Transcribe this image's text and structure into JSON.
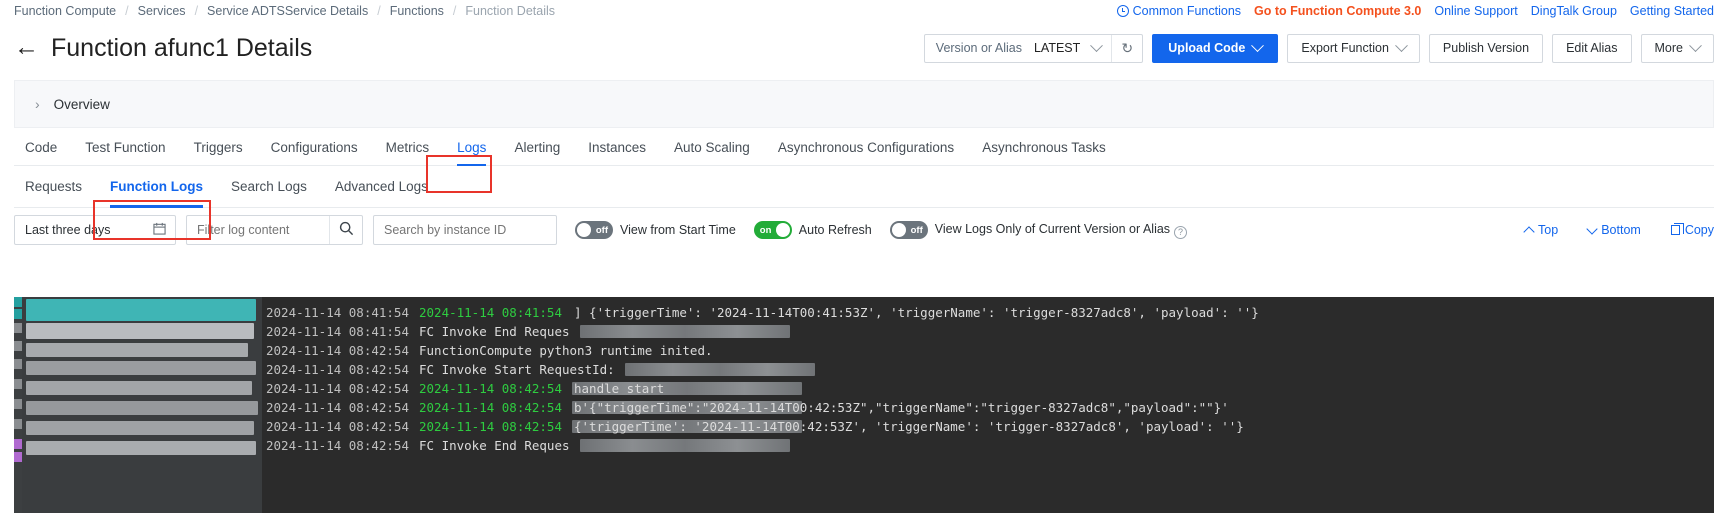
{
  "breadcrumb": {
    "items": [
      {
        "label": "Function Compute"
      },
      {
        "label": "Services"
      },
      {
        "label": "Service ADTSService Details"
      },
      {
        "label": "Functions"
      },
      {
        "label": "Function Details"
      }
    ],
    "separator": "/"
  },
  "top_links": [
    {
      "label": "Common Functions",
      "icon": "clock-icon",
      "accent": false
    },
    {
      "label": "Go to Function Compute 3.0",
      "accent": true
    },
    {
      "label": "Online Support",
      "accent": false
    },
    {
      "label": "DingTalk Group",
      "accent": false
    },
    {
      "label": "Getting Started",
      "accent": false
    }
  ],
  "header": {
    "back_icon": "←",
    "title": "Function afunc1 Details"
  },
  "version_selector": {
    "label": "Version or Alias",
    "value": "LATEST",
    "refresh_icon": "↻"
  },
  "actions": {
    "upload_code": "Upload Code",
    "export_function": "Export Function",
    "publish_version": "Publish Version",
    "edit_alias": "Edit Alias",
    "more": "More"
  },
  "overview": {
    "chevron": "›",
    "label": "Overview"
  },
  "tabs": [
    {
      "label": "Code",
      "active": false
    },
    {
      "label": "Test Function",
      "active": false
    },
    {
      "label": "Triggers",
      "active": false
    },
    {
      "label": "Configurations",
      "active": false
    },
    {
      "label": "Metrics",
      "active": false
    },
    {
      "label": "Logs",
      "active": true
    },
    {
      "label": "Alerting",
      "active": false
    },
    {
      "label": "Instances",
      "active": false
    },
    {
      "label": "Auto Scaling",
      "active": false
    },
    {
      "label": "Asynchronous Configurations",
      "active": false
    },
    {
      "label": "Asynchronous Tasks",
      "active": false
    }
  ],
  "subtabs": [
    {
      "label": "Requests",
      "active": false
    },
    {
      "label": "Function Logs",
      "active": true
    },
    {
      "label": "Search Logs",
      "active": false
    },
    {
      "label": "Advanced Logs",
      "active": false
    }
  ],
  "toolbar": {
    "date_range": "Last three days",
    "calendar_icon": "calendar-icon",
    "filter_placeholder": "Filter log content",
    "search_icon": "search-icon",
    "instance_placeholder": "Search by instance ID",
    "toggles": [
      {
        "state": "off",
        "on": false,
        "label": "View from Start Time",
        "help": false
      },
      {
        "state": "on",
        "on": true,
        "label": "Auto Refresh",
        "help": false
      },
      {
        "state": "off",
        "on": false,
        "label": "View Logs Only of Current Version or Alias",
        "help": true
      }
    ],
    "help_icon": "?",
    "top_label": "Top",
    "bottom_label": "Bottom",
    "copy_label": "Copy"
  },
  "annotations": {
    "accent_color": "#e8342a",
    "boxes": [
      {
        "target": "tab-logs"
      },
      {
        "target": "subtab-function-logs"
      }
    ]
  },
  "colors": {
    "primary_blue": "#1366ec",
    "accent_orange": "#f4511e",
    "toggle_on_green": "#22ac38",
    "annotation_red": "#e8342a",
    "console_bg": "#2b2b2b",
    "log_green": "#2ecc40"
  },
  "console": {
    "rows": [
      {
        "ts": "2024-11-14 08:41:54",
        "green": "2024-11-14  08:41:54",
        "white": "",
        "redact": 0
      },
      {
        "ts": "2024-11-14 08:41:54",
        "green": "",
        "white": "FC Invoke End Reques",
        "redact": 210
      },
      {
        "ts": "2024-11-14 08:42:54",
        "green": "",
        "white": "FunctionCompute python3 runtime inited.",
        "redact": 0
      },
      {
        "ts": "2024-11-14 08:42:54",
        "green": "",
        "white": "FC Invoke Start RequestId:",
        "redact": 180
      },
      {
        "ts": "2024-11-14 08:42:54",
        "green": "2024-11-14  08:42:54",
        "white": "",
        "redact": 230
      },
      {
        "ts": "2024-11-14 08:42:54",
        "green": "2024-11-14  08:42:54",
        "white": "",
        "redact": 230
      },
      {
        "ts": "2024-11-14 08:42:54",
        "green": "2024-11-14  08:42:54",
        "white": "",
        "redact": 230
      },
      {
        "ts": "2024-11-14 08:42:54",
        "green": "",
        "white": "FC Invoke End Reques",
        "redact": 210
      }
    ],
    "right_rows": [
      {
        "offset": 0,
        "text": "] {'triggerTime': '2024-11-14T00:41:53Z', 'triggerName': 'trigger-8327adc8', 'payload': ''}"
      },
      {
        "offset": 95,
        "text": "handle start"
      },
      {
        "offset": 114,
        "text": "b'{\"triggerTime\":\"2024-11-14T00:42:53Z\",\"triggerName\":\"trigger-8327adc8\",\"payload\":\"\"}'"
      },
      {
        "offset": 133,
        "text": "{'triggerTime': '2024-11-14T00:42:53Z', 'triggerName': 'trigger-8327adc8', 'payload': ''}"
      }
    ]
  }
}
